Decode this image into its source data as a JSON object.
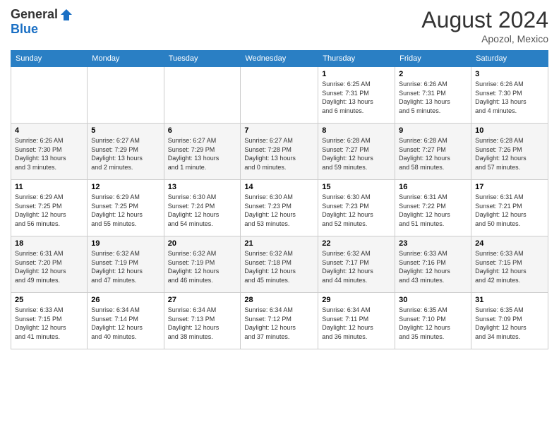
{
  "header": {
    "logo_general": "General",
    "logo_blue": "Blue",
    "month_year": "August 2024",
    "location": "Apozol, Mexico"
  },
  "calendar": {
    "days_of_week": [
      "Sunday",
      "Monday",
      "Tuesday",
      "Wednesday",
      "Thursday",
      "Friday",
      "Saturday"
    ],
    "weeks": [
      [
        {
          "day": "",
          "info": ""
        },
        {
          "day": "",
          "info": ""
        },
        {
          "day": "",
          "info": ""
        },
        {
          "day": "",
          "info": ""
        },
        {
          "day": "1",
          "info": "Sunrise: 6:25 AM\nSunset: 7:31 PM\nDaylight: 13 hours\nand 6 minutes."
        },
        {
          "day": "2",
          "info": "Sunrise: 6:26 AM\nSunset: 7:31 PM\nDaylight: 13 hours\nand 5 minutes."
        },
        {
          "day": "3",
          "info": "Sunrise: 6:26 AM\nSunset: 7:30 PM\nDaylight: 13 hours\nand 4 minutes."
        }
      ],
      [
        {
          "day": "4",
          "info": "Sunrise: 6:26 AM\nSunset: 7:30 PM\nDaylight: 13 hours\nand 3 minutes."
        },
        {
          "day": "5",
          "info": "Sunrise: 6:27 AM\nSunset: 7:29 PM\nDaylight: 13 hours\nand 2 minutes."
        },
        {
          "day": "6",
          "info": "Sunrise: 6:27 AM\nSunset: 7:29 PM\nDaylight: 13 hours\nand 1 minute."
        },
        {
          "day": "7",
          "info": "Sunrise: 6:27 AM\nSunset: 7:28 PM\nDaylight: 13 hours\nand 0 minutes."
        },
        {
          "day": "8",
          "info": "Sunrise: 6:28 AM\nSunset: 7:27 PM\nDaylight: 12 hours\nand 59 minutes."
        },
        {
          "day": "9",
          "info": "Sunrise: 6:28 AM\nSunset: 7:27 PM\nDaylight: 12 hours\nand 58 minutes."
        },
        {
          "day": "10",
          "info": "Sunrise: 6:28 AM\nSunset: 7:26 PM\nDaylight: 12 hours\nand 57 minutes."
        }
      ],
      [
        {
          "day": "11",
          "info": "Sunrise: 6:29 AM\nSunset: 7:25 PM\nDaylight: 12 hours\nand 56 minutes."
        },
        {
          "day": "12",
          "info": "Sunrise: 6:29 AM\nSunset: 7:25 PM\nDaylight: 12 hours\nand 55 minutes."
        },
        {
          "day": "13",
          "info": "Sunrise: 6:30 AM\nSunset: 7:24 PM\nDaylight: 12 hours\nand 54 minutes."
        },
        {
          "day": "14",
          "info": "Sunrise: 6:30 AM\nSunset: 7:23 PM\nDaylight: 12 hours\nand 53 minutes."
        },
        {
          "day": "15",
          "info": "Sunrise: 6:30 AM\nSunset: 7:23 PM\nDaylight: 12 hours\nand 52 minutes."
        },
        {
          "day": "16",
          "info": "Sunrise: 6:31 AM\nSunset: 7:22 PM\nDaylight: 12 hours\nand 51 minutes."
        },
        {
          "day": "17",
          "info": "Sunrise: 6:31 AM\nSunset: 7:21 PM\nDaylight: 12 hours\nand 50 minutes."
        }
      ],
      [
        {
          "day": "18",
          "info": "Sunrise: 6:31 AM\nSunset: 7:20 PM\nDaylight: 12 hours\nand 49 minutes."
        },
        {
          "day": "19",
          "info": "Sunrise: 6:32 AM\nSunset: 7:19 PM\nDaylight: 12 hours\nand 47 minutes."
        },
        {
          "day": "20",
          "info": "Sunrise: 6:32 AM\nSunset: 7:19 PM\nDaylight: 12 hours\nand 46 minutes."
        },
        {
          "day": "21",
          "info": "Sunrise: 6:32 AM\nSunset: 7:18 PM\nDaylight: 12 hours\nand 45 minutes."
        },
        {
          "day": "22",
          "info": "Sunrise: 6:32 AM\nSunset: 7:17 PM\nDaylight: 12 hours\nand 44 minutes."
        },
        {
          "day": "23",
          "info": "Sunrise: 6:33 AM\nSunset: 7:16 PM\nDaylight: 12 hours\nand 43 minutes."
        },
        {
          "day": "24",
          "info": "Sunrise: 6:33 AM\nSunset: 7:15 PM\nDaylight: 12 hours\nand 42 minutes."
        }
      ],
      [
        {
          "day": "25",
          "info": "Sunrise: 6:33 AM\nSunset: 7:15 PM\nDaylight: 12 hours\nand 41 minutes."
        },
        {
          "day": "26",
          "info": "Sunrise: 6:34 AM\nSunset: 7:14 PM\nDaylight: 12 hours\nand 40 minutes."
        },
        {
          "day": "27",
          "info": "Sunrise: 6:34 AM\nSunset: 7:13 PM\nDaylight: 12 hours\nand 38 minutes."
        },
        {
          "day": "28",
          "info": "Sunrise: 6:34 AM\nSunset: 7:12 PM\nDaylight: 12 hours\nand 37 minutes."
        },
        {
          "day": "29",
          "info": "Sunrise: 6:34 AM\nSunset: 7:11 PM\nDaylight: 12 hours\nand 36 minutes."
        },
        {
          "day": "30",
          "info": "Sunrise: 6:35 AM\nSunset: 7:10 PM\nDaylight: 12 hours\nand 35 minutes."
        },
        {
          "day": "31",
          "info": "Sunrise: 6:35 AM\nSunset: 7:09 PM\nDaylight: 12 hours\nand 34 minutes."
        }
      ]
    ]
  }
}
